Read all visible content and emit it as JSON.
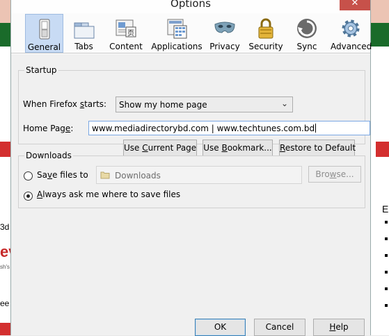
{
  "window": {
    "title": "Options",
    "close_glyph": "✕"
  },
  "toolbar": {
    "tabs": [
      {
        "label": "General",
        "icon": "switch-icon",
        "active": true
      },
      {
        "label": "Tabs",
        "icon": "tabs-icon",
        "active": false
      },
      {
        "label": "Content",
        "icon": "content-icon",
        "active": false
      },
      {
        "label": "Applications",
        "icon": "applications-icon",
        "active": false
      },
      {
        "label": "Privacy",
        "icon": "mask-icon",
        "active": false
      },
      {
        "label": "Security",
        "icon": "lock-icon",
        "active": false
      },
      {
        "label": "Sync",
        "icon": "sync-icon",
        "active": false
      },
      {
        "label": "Advanced",
        "icon": "gear-icon",
        "active": false
      }
    ]
  },
  "startup": {
    "legend": "Startup",
    "when_starts_label": "When Firefox starts:",
    "when_starts_value": "Show my home page",
    "home_page_label": "Home Page:",
    "home_page_value": "www.mediadirectorybd.com | www.techtunes.com.bd",
    "use_current_page": "Use Current Page",
    "use_bookmark": "Use Bookmark...",
    "restore_default": "Restore to Default"
  },
  "downloads": {
    "legend": "Downloads",
    "save_files_to_label": "Save files to",
    "save_folder": "Downloads",
    "browse": "Browse...",
    "always_ask_label": "Always ask me where to save files",
    "selected": "always_ask"
  },
  "footer": {
    "ok": "OK",
    "cancel": "Cancel",
    "help": "Help"
  },
  "background_page": {
    "left_text_1": "3d",
    "left_text_2": "ev",
    "left_text_3": "sh's",
    "left_text_4": "ee",
    "right_text_1": "E"
  },
  "colors": {
    "active_tab_bg": "#c8dbf4",
    "dialog_bg": "#f0f0f0",
    "textbox_focus_border": "#7aa7e3",
    "bg_green": "#1a6b2a",
    "bg_red": "#d32f2f"
  }
}
